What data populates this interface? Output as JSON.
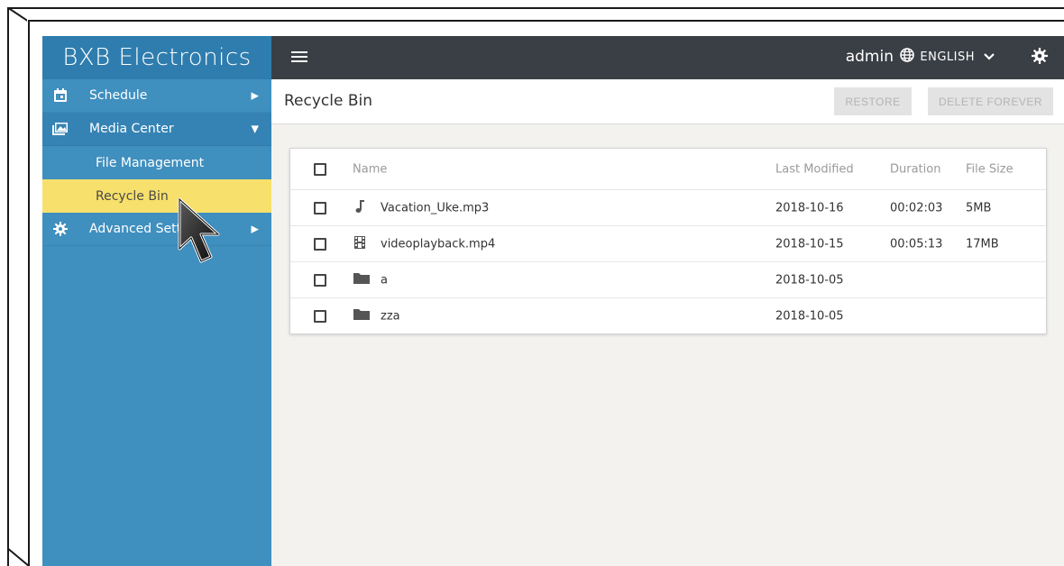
{
  "brand": "BXB Electronics",
  "topbar": {
    "user": "admin",
    "language": "ENGLISH"
  },
  "sidebar": {
    "items": [
      {
        "label": "Schedule",
        "icon": "calendar-icon"
      },
      {
        "label": "Media Center",
        "icon": "media-icon"
      },
      {
        "label": "File Management"
      },
      {
        "label": "Recycle Bin"
      },
      {
        "label": "Advanced Sett",
        "icon": "gear-icon"
      }
    ]
  },
  "page": {
    "title": "Recycle Bin",
    "restore_label": "RESTORE",
    "delete_label": "DELETE FOREVER"
  },
  "table": {
    "headers": {
      "name": "Name",
      "modified": "Last Modified",
      "duration": "Duration",
      "size": "File Size"
    },
    "rows": [
      {
        "name": "Vacation_Uke.mp3",
        "modified": "2018-10-16",
        "duration": "00:02:03",
        "size": "5MB",
        "icon": "music-note-icon"
      },
      {
        "name": "videoplayback.mp4",
        "modified": "2018-10-15",
        "duration": "00:05:13",
        "size": "17MB",
        "icon": "film-icon"
      },
      {
        "name": "a",
        "modified": "2018-10-05",
        "duration": "",
        "size": "",
        "icon": "folder-icon"
      },
      {
        "name": "zza",
        "modified": "2018-10-05",
        "duration": "",
        "size": "",
        "icon": "folder-icon"
      }
    ]
  },
  "colors": {
    "sidebar": "#3f8fbf",
    "brand_bg": "#2f7dae",
    "topbar": "#3a3f45",
    "active": "#f7e06b",
    "content_bg": "#f3f2ef"
  }
}
